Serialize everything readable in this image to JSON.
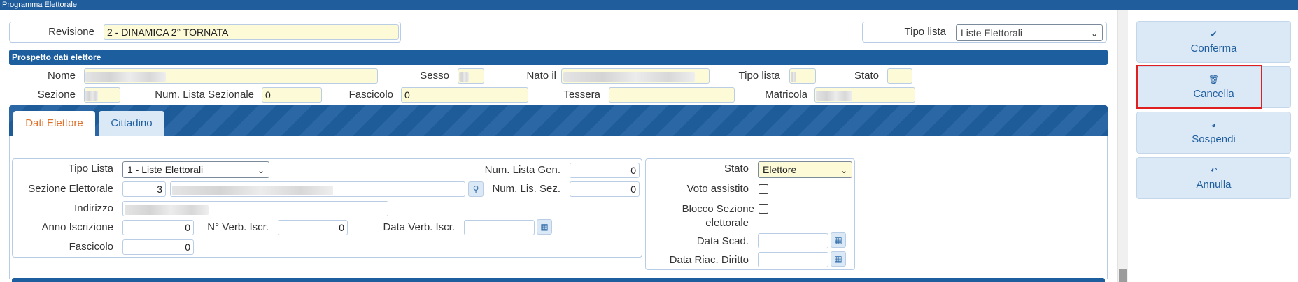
{
  "window": {
    "title": "Programma Elettorale"
  },
  "header": {
    "revisione_label": "Revisione",
    "revisione_value": "2 - DINAMICA 2° TORNATA",
    "tipo_lista_label": "Tipo lista",
    "tipo_lista_value": "Liste Elettorali"
  },
  "prospetto": {
    "title": "Prospetto dati elettore",
    "nome_label": "Nome",
    "sesso_label": "Sesso",
    "nato_label": "Nato il",
    "tipo_lista_label": "Tipo lista",
    "stato_label": "Stato",
    "sezione_label": "Sezione",
    "num_lista_sez_label": "Num. Lista Sezionale",
    "num_lista_sez_value": "0",
    "fascicolo_label": "Fascicolo",
    "fascicolo_value": "0",
    "tessera_label": "Tessera",
    "matricola_label": "Matricola"
  },
  "tabs": [
    {
      "label": "Dati Elettore"
    },
    {
      "label": "Cittadino"
    }
  ],
  "dati_elettore": {
    "tipo_lista_label": "Tipo Lista",
    "tipo_lista_value": "1 - Liste Elettorali",
    "num_lista_gen_label": "Num. Lista Gen.",
    "num_lista_gen_value": "0",
    "sezione_elettorale_label": "Sezione Elettorale",
    "sezione_elettorale_value": "3",
    "num_lis_sez_label": "Num. Lis. Sez.",
    "num_lis_sez_value": "0",
    "indirizzo_label": "Indirizzo",
    "anno_iscrizione_label": "Anno Iscrizione",
    "anno_iscrizione_value": "0",
    "n_verb_iscr_label": "N° Verb. Iscr.",
    "n_verb_iscr_value": "0",
    "data_verb_iscr_label": "Data Verb. Iscr.",
    "fascicolo_label": "Fascicolo",
    "fascicolo_value": "0"
  },
  "stato_panel": {
    "stato_label": "Stato",
    "stato_value": "Elettore",
    "voto_assistito_label": "Voto assistito",
    "blocco_sezione_label_1": "Blocco Sezione",
    "blocco_sezione_label_2": "elettorale",
    "data_scad_label": "Data Scad.",
    "data_riac_label": "Data Riac. Diritto"
  },
  "actions": {
    "conferma": "Conferma",
    "cancella": "Cancella",
    "sospendi": "Sospendi",
    "annulla": "Annulla"
  },
  "colors": {
    "brand_blue": "#1f5d9c",
    "input_yellow": "#fdfbd7",
    "active_tab_text": "#e0702a",
    "highlight_red": "#e02020"
  }
}
